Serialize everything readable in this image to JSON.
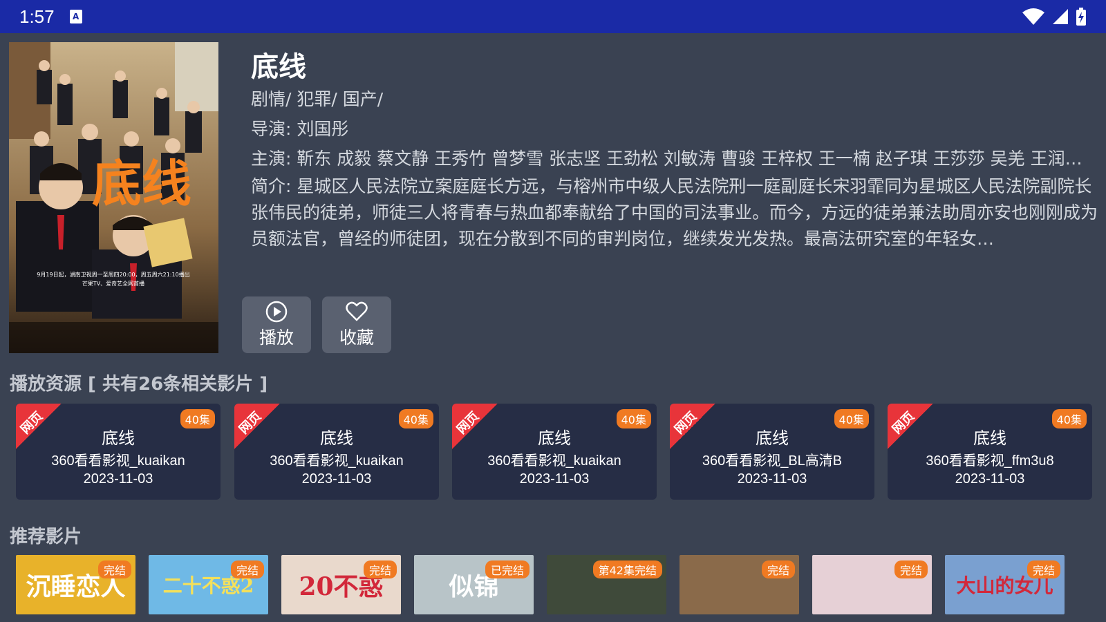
{
  "status_bar": {
    "time": "1:57",
    "notification_icon_label": "A",
    "icons": [
      "wifi-icon",
      "signal-icon",
      "battery-icon"
    ]
  },
  "movie": {
    "title": "底线",
    "genre": "剧情/ 犯罪/ 国产/",
    "director": "导演: 刘国彤",
    "cast": "主演: 靳东 成毅 蔡文静 王秀竹 曾梦雪 张志坚 王劲松 刘敏涛 曹骏 王梓权 王一楠 赵子琪 王莎莎 吴羌 王润…",
    "synopsis": "简介: 星城区人民法院立案庭庭长方远，与榕州市中级人民法院刑一庭副庭长宋羽霏同为星城区人民法院副院长张伟民的徒弟，师徒三人将青春与热血都奉献给了中国的司法事业。而今，方远的徒弟兼法助周亦安也刚刚成为员额法官，曾经的师徒团，现在分散到不同的审判岗位，继续发光发热。最高法研究室的年轻女…",
    "poster_text": "底线",
    "poster_caption": "9月19日起，湖南卫视周一至周四20:00，周五周六21:10播出",
    "poster_caption2": "芒果TV、爱奇艺全网首播"
  },
  "actions": {
    "play_label": "播放",
    "favorite_label": "收藏"
  },
  "sources": {
    "heading": "播放资源 [ 共有26条相关影片 ]",
    "items": [
      {
        "ribbon": "网页",
        "episodes": "40集",
        "title": "底线",
        "name": "360看看影视_kuaikan",
        "date": "2023-11-03"
      },
      {
        "ribbon": "网页",
        "episodes": "40集",
        "title": "底线",
        "name": "360看看影视_kuaikan",
        "date": "2023-11-03"
      },
      {
        "ribbon": "网页",
        "episodes": "40集",
        "title": "底线",
        "name": "360看看影视_kuaikan",
        "date": "2023-11-03"
      },
      {
        "ribbon": "网页",
        "episodes": "40集",
        "title": "底线",
        "name": "360看看影视_BL高清B",
        "date": "2023-11-03"
      },
      {
        "ribbon": "网页",
        "episodes": "40集",
        "title": "底线",
        "name": "360看看影视_ffm3u8",
        "date": "2023-11-03"
      }
    ]
  },
  "recommendations": {
    "heading": "推荐影片",
    "items": [
      {
        "badge": "完结",
        "art_text": "沉睡恋人",
        "bg": "#e8b22a",
        "fg": "#ffffff"
      },
      {
        "badge": "完结",
        "art_text": "二十不惑2",
        "bg": "#6fb9e6",
        "fg": "#f4e05a"
      },
      {
        "badge": "完结",
        "art_text": "20不惑",
        "bg": "#e9d9cc",
        "fg": "#d2283a"
      },
      {
        "badge": "已完结",
        "art_text": "似锦",
        "bg": "#b8c4c8",
        "fg": "#ffffff"
      },
      {
        "badge": "第42集完结",
        "art_text": "",
        "bg": "#3f4a3a",
        "fg": "#ffffff"
      },
      {
        "badge": "完结",
        "art_text": "",
        "bg": "#8a6a4a",
        "fg": "#ffffff"
      },
      {
        "badge": "完结",
        "art_text": "",
        "bg": "#e6d0d6",
        "fg": "#ffffff"
      },
      {
        "badge": "完结",
        "art_text": "大山的女儿",
        "bg": "#7aa0d0",
        "fg": "#d2283a"
      }
    ]
  },
  "colors": {
    "status_bar": "#1a2aa6",
    "background": "#3a4252",
    "card": "#262d45",
    "ribbon": "#e8343a",
    "badge": "#f07a22"
  }
}
